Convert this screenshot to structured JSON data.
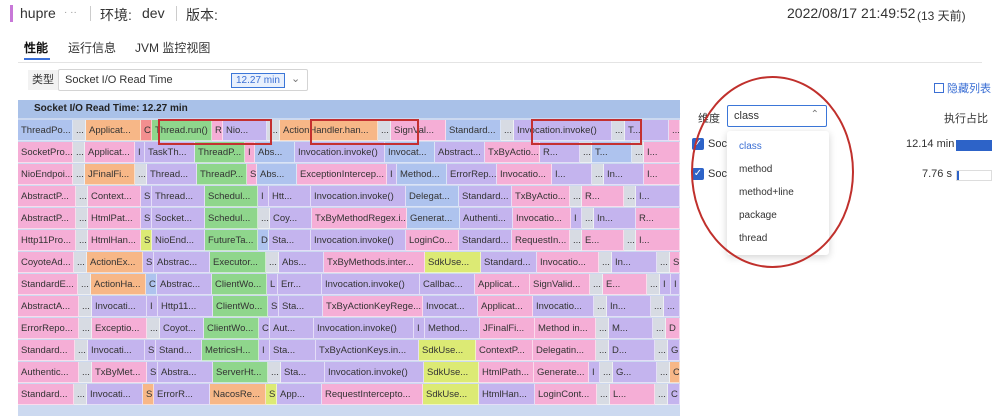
{
  "header": {
    "app_name": "hupre",
    "app_name_suffix": "· ··",
    "env_label": "环境:",
    "env_value": "dev",
    "version_label": "版本:",
    "timestamp": "2022/08/17 21:49:52",
    "relative_time": "(13 天前)"
  },
  "tabs": [
    "性能",
    "运行信息",
    "JVM 监控视图"
  ],
  "toolbar": {
    "type_label": "类型",
    "type_value": "Socket I/O Read Time",
    "type_badge": "12.27 min",
    "hide_columns": "隐藏列表"
  },
  "flame": {
    "title": "Socket I/O Read Time: 12.27 min",
    "rows": [
      [
        "ThreadPo...",
        "...",
        "Applicat...",
        "C",
        "Thread.run()",
        "R",
        "Nio...",
        "...",
        "ActionHandler.han...",
        "...",
        "SignVal...",
        "Standard...",
        "...",
        "Invocation.invoke()",
        "...",
        "T...",
        "..."
      ],
      [
        "SocketPro...",
        "...",
        "Applicat...",
        "I",
        "TaskTh...",
        "ThreadP...",
        "I",
        "Abs...",
        "Invocation.invoke()",
        "Invocat...",
        "Abstract...",
        "TxByActio...",
        "R...",
        "...",
        "T...",
        "...",
        "I..."
      ],
      [
        "NioEndpoi...",
        "...",
        "JFinalFi...",
        "...",
        "Thread...",
        "ThreadP...",
        "S",
        "Abs...",
        "ExceptionIntercep...",
        "I",
        "Method...",
        "ErrorRep...",
        "Invocatio...",
        "I...",
        "...",
        "In...",
        "I..."
      ],
      [
        "AbstractP...",
        "...",
        "Context...",
        "S",
        "Thread...",
        "Schedul...",
        "I",
        "Htt...",
        "Invocation.invoke()",
        "Delegat...",
        "Standard...",
        "TxByActio...",
        "...",
        "R...",
        "...",
        "I..."
      ],
      [
        "AbstractP...",
        "...",
        "HtmlPat...",
        "S",
        "Socket...",
        "Schedul...",
        "...",
        "Coy...",
        "TxByMethodRegex.i...",
        "Generat...",
        "Authenti...",
        "Invocatio...",
        "I",
        "...",
        "In...",
        "R..."
      ],
      [
        "Http11Pro...",
        "...",
        "HtmlHan...",
        "S",
        "NioEnd...",
        "FutureTa...",
        "D",
        "Sta...",
        "Invocation.invoke()",
        "LoginCo...",
        "Standard...",
        "RequestIn...",
        "...",
        "E...",
        "...",
        "I..."
      ],
      [
        "CoyoteAd...",
        "...",
        "ActionEx...",
        "S",
        "Abstrac...",
        "Executor...",
        "...",
        "Abs...",
        "TxByMethods.inter...",
        "SdkUse...",
        "Standard...",
        "Invocatio...",
        "...",
        "In...",
        "...",
        "S"
      ],
      [
        "StandardE...",
        "...",
        "ActionHa...",
        "C",
        "Abstrac...",
        "ClientWo...",
        "L",
        "Err...",
        "Invocation.invoke()",
        "Callbac...",
        "Applicat...",
        "SignValid...",
        "...",
        "E...",
        "...",
        "I",
        "I"
      ],
      [
        "AbstractA...",
        "...",
        "Invocati...",
        "I",
        "Http11...",
        "ClientWo...",
        "S",
        "Sta...",
        "TxByActionKeyRege...",
        "Invocat...",
        "Applicat...",
        "Invocatio...",
        "...",
        "In...",
        "...",
        "..."
      ],
      [
        "ErrorRepo...",
        "...",
        "Exceptio...",
        "...",
        "Coyot...",
        "ClientWo...",
        "C",
        "Aut...",
        "Invocation.invoke()",
        "I",
        "Method...",
        "JFinalFi...",
        "Method in...",
        "...",
        "M...",
        "...",
        "D"
      ],
      [
        "Standard...",
        "...",
        "Invocati...",
        "S",
        "Stand...",
        "MetricsH...",
        "I",
        "Sta...",
        "TxByActionKeys.in...",
        "SdkUse...",
        "ContextP...",
        "Delegatin...",
        "...",
        "D...",
        "...",
        "G"
      ],
      [
        "Authentic...",
        "...",
        "TxByMet...",
        "S",
        "Abstra...",
        "ServerHt...",
        "...",
        "Sta...",
        "Invocation.invoke()",
        "SdkUse...",
        "HtmlPath...",
        "Generate...",
        "I",
        "...",
        "G...",
        "...",
        "C"
      ],
      [
        "Standard...",
        "...",
        "Invocati...",
        "S",
        "ErrorR...",
        "NacosRe...",
        "S",
        "App...",
        "RequestIntercepto...",
        "SdkUse...",
        "HtmlHan...",
        "LoginCont...",
        "...",
        "L...",
        "...",
        "C"
      ]
    ]
  },
  "panel": {
    "dim_label": "维度",
    "dim_value": "class",
    "pct_label": "执行占比",
    "rows": [
      {
        "name": "Sock",
        "value": "12.14 min",
        "fraction": 0.99
      },
      {
        "name": "Sock",
        "value": "7.76 s",
        "fraction": 0.01
      }
    ],
    "options": [
      "class",
      "method",
      "method+line",
      "package",
      "thread"
    ]
  },
  "colors": {
    "accent": "#3b6fd4",
    "highlight": "#c43030",
    "checkbox": "#2d63c8"
  }
}
